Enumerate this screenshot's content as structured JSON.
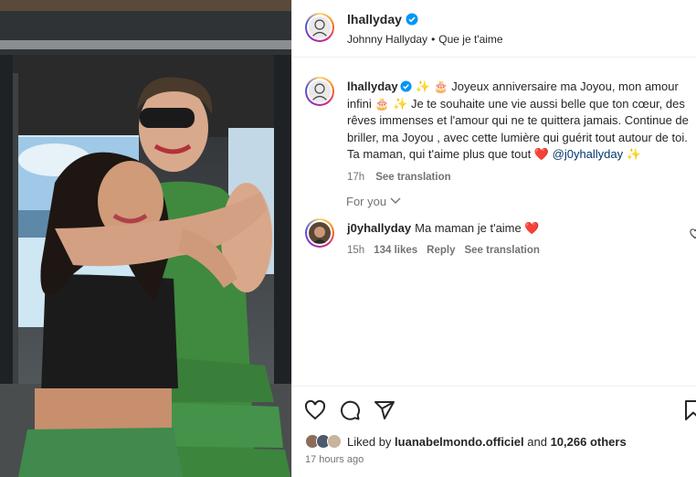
{
  "post_image": {
    "description_icon": "photo-of-two-women-hugging"
  },
  "header": {
    "username": "lhallyday",
    "subtitle_artist": "Johnny Hallyday",
    "subtitle_separator": "•",
    "subtitle_track": "Que je t'aime",
    "verified_icon": "verified-badge-icon"
  },
  "caption": {
    "username": "lhallyday",
    "text_before_mention": "✨ 🎂 Joyeux anniversaire ma Joyou, mon amour infini 🎂 ✨ Je te souhaite une vie aussi belle que ton cœur, des rêves immenses et l'amour qui ne te quittera jamais. Continue de briller, ma Joyou , avec cette lumière qui guérit tout autour de toi. Ta maman, qui t'aime plus que tout ❤️",
    "mention": "@j0yhallyday",
    "text_after_mention": "✨",
    "time": "17h",
    "see_translation": "See translation"
  },
  "for_you": {
    "label": "For you",
    "chevron_icon": "chevron-down-icon"
  },
  "comment": {
    "username": "j0yhallyday",
    "text": "Ma maman je t'aime ❤️",
    "time": "15h",
    "likes": "134 likes",
    "reply": "Reply",
    "see_translation": "See translation"
  },
  "actions": {
    "like_icon": "heart-icon",
    "comment_icon": "comment-icon",
    "share_icon": "share-icon",
    "save_icon": "bookmark-icon"
  },
  "likes": {
    "prefix": "Liked by",
    "user": "luanabelmondo.officiel",
    "joiner": "and",
    "others": "10,266 others"
  },
  "posted_ago": "17 hours ago",
  "colors": {
    "accent_link": "#00376b",
    "verified": "#0095f6",
    "heart": "#ed4956",
    "secondary_text": "#737373"
  }
}
